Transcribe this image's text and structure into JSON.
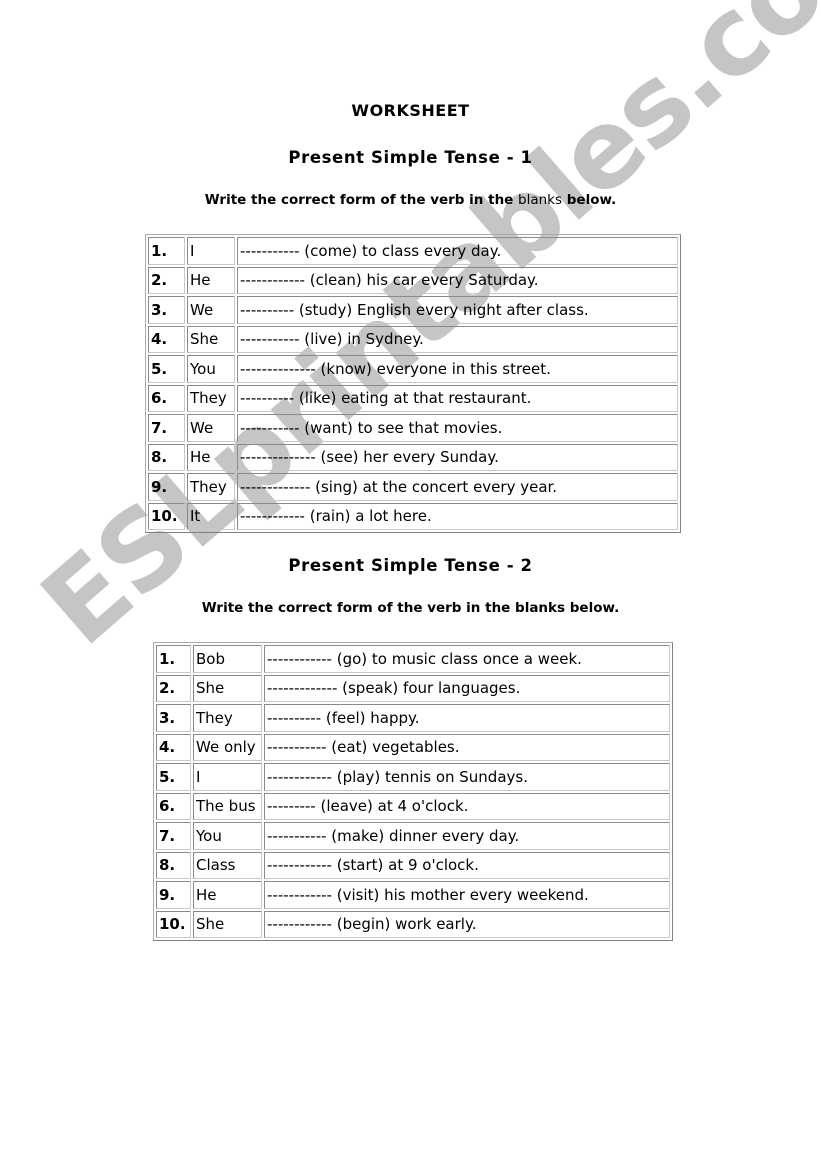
{
  "worksheet_title": "WORKSHEET",
  "watermark": "ESLprintables.com",
  "sections": [
    {
      "title": "Present Simple Tense - 1",
      "instruction_bold_1": "Write the correct form of the verb in the ",
      "instruction_light": "blanks",
      "instruction_bold_2": " below.",
      "rows": [
        {
          "num": "1.",
          "subject": "I",
          "sentence": "----------- (come) to class every day."
        },
        {
          "num": "2.",
          "subject": "He",
          "sentence": "------------ (clean) his car every Saturday."
        },
        {
          "num": "3.",
          "subject": "We",
          "sentence": "---------- (study) English every night after class."
        },
        {
          "num": "4.",
          "subject": "She",
          "sentence": "----------- (live) in Sydney."
        },
        {
          "num": "5.",
          "subject": "You",
          "sentence": "-------------- (know) everyone in this street."
        },
        {
          "num": "6.",
          "subject": "They",
          "sentence": "---------- (like) eating at that restaurant."
        },
        {
          "num": "7.",
          "subject": "We",
          "sentence": "----------- (want) to see that movies."
        },
        {
          "num": "8.",
          "subject": "He",
          "sentence": "-------------- (see) her every Sunday."
        },
        {
          "num": "9.",
          "subject": "They",
          "sentence": "------------- (sing) at the concert every year."
        },
        {
          "num": "10.",
          "subject": "It",
          "sentence": "------------ (rain) a lot here."
        }
      ]
    },
    {
      "title": "Present Simple Tense - 2",
      "instruction": "Write the correct form of the verb in the blanks below.",
      "rows": [
        {
          "num": "1.",
          "subject": "Bob",
          "sentence": "------------ (go) to music class once a week."
        },
        {
          "num": "2.",
          "subject": "She",
          "sentence": "------------- (speak) four languages."
        },
        {
          "num": "3.",
          "subject": "They",
          "sentence": "---------- (feel) happy."
        },
        {
          "num": "4.",
          "subject": "We only",
          "sentence": "----------- (eat) vegetables."
        },
        {
          "num": "5.",
          "subject": "I",
          "sentence": "------------ (play) tennis on Sundays."
        },
        {
          "num": "6.",
          "subject": "The bus",
          "sentence": "--------- (leave) at 4 o'clock."
        },
        {
          "num": "7.",
          "subject": "You",
          "sentence": "----------- (make) dinner every day."
        },
        {
          "num": "8.",
          "subject": "Class",
          "sentence": "------------ (start) at 9 o'clock."
        },
        {
          "num": "9.",
          "subject": "He",
          "sentence": "------------ (visit) his mother every weekend."
        },
        {
          "num": "10.",
          "subject": "She",
          "sentence": "------------ (begin) work early."
        }
      ]
    }
  ]
}
